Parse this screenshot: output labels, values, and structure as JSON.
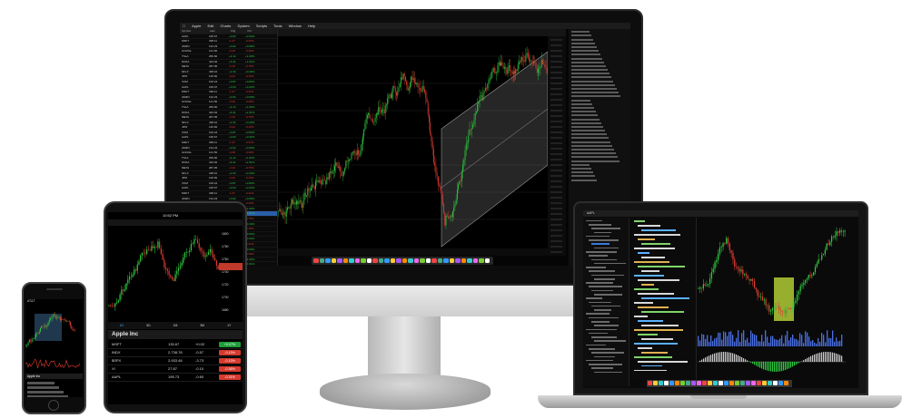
{
  "desktop": {
    "menu": [
      "Apple",
      "Edit",
      "Charts",
      "System",
      "Scripts",
      "Tools",
      "Window",
      "Help"
    ],
    "watchlist": {
      "headers": [
        "Symbol",
        "Last",
        "Chg",
        "Pct",
        "Vol"
      ],
      "rows": [
        [
          "AAPL",
          "195.67",
          "+0.63",
          "+0.32%",
          ""
        ],
        [
          "MSFT",
          "338.11",
          "-1.07",
          "-0.31%",
          ""
        ],
        [
          "AMZN",
          "134.23",
          "+0.92",
          "+0.69%",
          ""
        ],
        [
          "GOOGL",
          "121.50",
          "-0.48",
          "-0.39%",
          ""
        ],
        [
          "TSLA",
          "256.60",
          "+4.12",
          "+1.63%",
          ""
        ],
        [
          "NVDA",
          "423.02",
          "+6.31",
          "+1.51%",
          ""
        ],
        [
          "META",
          "287.05",
          "-2.16",
          "-0.75%",
          ""
        ],
        [
          "NFLX",
          "438.10",
          "+1.94",
          "+0.44%",
          ""
        ],
        [
          "JPM",
          "145.82",
          "-0.22",
          "-0.15%",
          ""
        ],
        [
          "XOM",
          "106.24",
          "+0.87",
          "+0.83%",
          ""
        ]
      ]
    },
    "chart": {
      "symbol": "Daily"
    },
    "dock_count": 30
  },
  "tablet": {
    "status_time": "10:52 PM",
    "quote_title": "Apple Inc",
    "time_tabs": [
      "1D",
      "5D",
      "1M",
      "3M",
      "1Y"
    ],
    "rows": [
      {
        "symbol": "MSFT",
        "last": "135.67",
        "chg": "+0.02",
        "pct": "+0.07%",
        "color": "#1f9d3a"
      },
      {
        "symbol": "INDX",
        "last": "2,738.78",
        "chg": "-0.57",
        "pct": "-0.13%",
        "color": "#d63a2f"
      },
      {
        "symbol": "$SPX",
        "last": "2,933.48",
        "chg": "-3.73",
        "pct": "-0.13%",
        "color": "#d63a2f"
      },
      {
        "symbol": "XI",
        "last": "27.87",
        "chg": "-0.10",
        "pct": "-0.36%",
        "color": "#d63a2f"
      },
      {
        "symbol": "AAPL",
        "last": "195.73",
        "chg": "-0.60",
        "pct": "-0.31%",
        "color": "#d63a2f"
      }
    ],
    "price_ticks": [
      "1800",
      "1780",
      "1760",
      "1740",
      "1720",
      "1700",
      "1680"
    ]
  },
  "phone": {
    "status": "AT&T",
    "section_title": "Apple Inc"
  },
  "laptop": {
    "toolbar_label": "AAPL"
  },
  "colors": {
    "up": "#2ecc40",
    "down": "#e03c31",
    "channel": "#9a9a9a",
    "highlight": "#c8e63c",
    "volume": "#4a6fe3"
  }
}
